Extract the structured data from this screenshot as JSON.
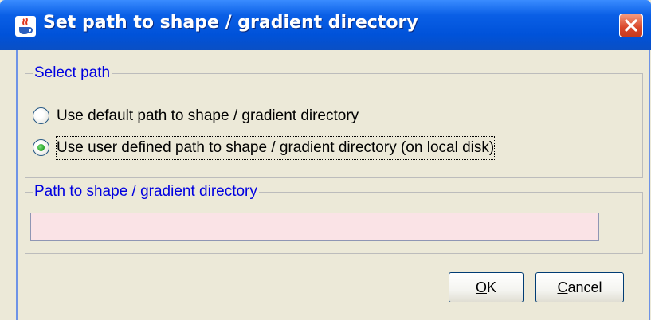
{
  "window": {
    "title": "Set path to shape / gradient directory",
    "icons": {
      "app": "java-cup-icon",
      "close": "close-icon"
    }
  },
  "select_path_group": {
    "legend": "Select path",
    "options": [
      {
        "label": "Use default path to shape / gradient directory",
        "selected": false
      },
      {
        "label": "Use user defined path to shape / gradient directory (on local disk)",
        "selected": true
      }
    ]
  },
  "path_group": {
    "legend": "Path to shape / gradient directory",
    "input_value": ""
  },
  "buttons": {
    "ok": {
      "mnemonic": "O",
      "rest": "K"
    },
    "cancel": {
      "mnemonic": "C",
      "rest": "ancel"
    }
  },
  "colors": {
    "titlebar": "#0052d9",
    "legend_text": "#0000e0",
    "input_background": "#fae3e6",
    "dialog_background": "#ece9d8"
  }
}
